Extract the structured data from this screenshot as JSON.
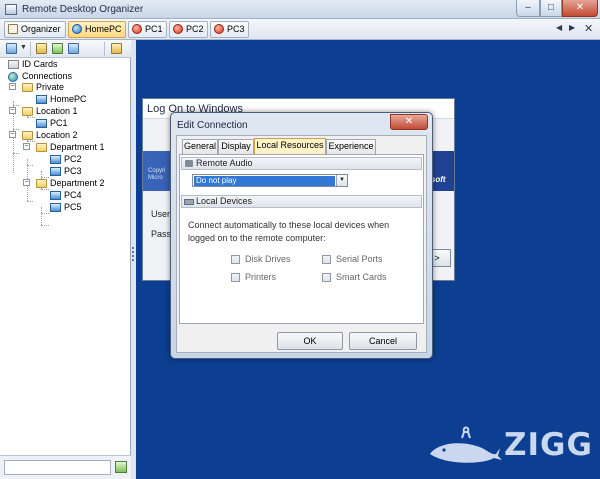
{
  "window": {
    "title": "Remote Desktop Organizer",
    "min": "–",
    "max": "□",
    "close": "✕"
  },
  "tabs": [
    {
      "label": "Organizer",
      "icon": "organizer-icon"
    },
    {
      "label": "HomePC",
      "icon": "computer-blue-icon",
      "active": true
    },
    {
      "label": "PC1",
      "icon": "computer-red-icon"
    },
    {
      "label": "PC2",
      "icon": "computer-red-icon"
    },
    {
      "label": "PC3",
      "icon": "computer-red-icon"
    }
  ],
  "tabstrip": {
    "left_arrow": "◀",
    "right_arrow": "▶",
    "close": "✕"
  },
  "tree": {
    "id_cards": "ID Cards",
    "connections": "Connections",
    "private": "Private",
    "homepc": "HomePC",
    "location1": "Location 1",
    "pc1": "PC1",
    "location2": "Location 2",
    "department1": "Department 1",
    "pc2": "PC2",
    "pc3": "PC3",
    "department2": "Department 2",
    "pc4": "PC4",
    "pc5": "PC5"
  },
  "logon": {
    "title": "Log On to Windows",
    "copyright": "Copyri",
    "microsoft": "Micro",
    "brand": "osoft",
    "user_label": "User",
    "password_label": "Passv",
    "options_btn": ">"
  },
  "dialog": {
    "title": "Edit Connection",
    "close": "✕",
    "tabs": [
      "General",
      "Display",
      "Local Resources",
      "Experience"
    ],
    "active_tab": "Local Resources",
    "remote_audio": {
      "header": "Remote Audio",
      "selected": "Do not play",
      "arrow": "▼"
    },
    "local_devices": {
      "header": "Local Devices",
      "description": "Connect automatically to these local devices when logged on to the remote computer:",
      "options": [
        {
          "label": "Disk Drives",
          "checked": false
        },
        {
          "label": "Serial Ports",
          "checked": false
        },
        {
          "label": "Printers",
          "checked": false
        },
        {
          "label": "Smart Cards",
          "checked": false
        }
      ]
    },
    "ok": "OK",
    "cancel": "Cancel"
  },
  "watermark": {
    "text": "ZIGG",
    "icon": "whale-icon"
  },
  "colors": {
    "desktop": "#0c3f92",
    "active_tab": "#ffd782",
    "selection": "#3178d6"
  }
}
